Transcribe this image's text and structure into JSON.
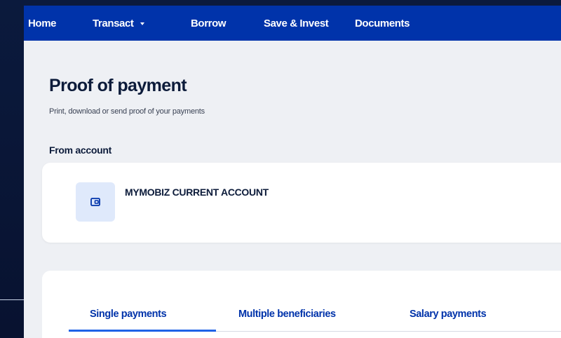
{
  "nav": {
    "items": [
      {
        "label": "Home"
      },
      {
        "label": "Transact"
      },
      {
        "label": "Borrow"
      },
      {
        "label": "Save & Invest"
      },
      {
        "label": "Documents"
      }
    ]
  },
  "page": {
    "title": "Proof of payment",
    "subtitle": "Print, download or send proof of your payments"
  },
  "from_account": {
    "label": "From account",
    "account_name": "MYMOBIZ CURRENT ACCOUNT",
    "icon": "wallet-icon"
  },
  "tabs": [
    {
      "label": "Single payments",
      "active": true
    },
    {
      "label": "Multiple beneficiaries",
      "active": false
    },
    {
      "label": "Salary payments",
      "active": false
    }
  ],
  "colors": {
    "nav_bg": "#0033aa",
    "accent": "#1f62e6",
    "backdrop": "#0a1633",
    "content_bg": "#eef0f4"
  }
}
